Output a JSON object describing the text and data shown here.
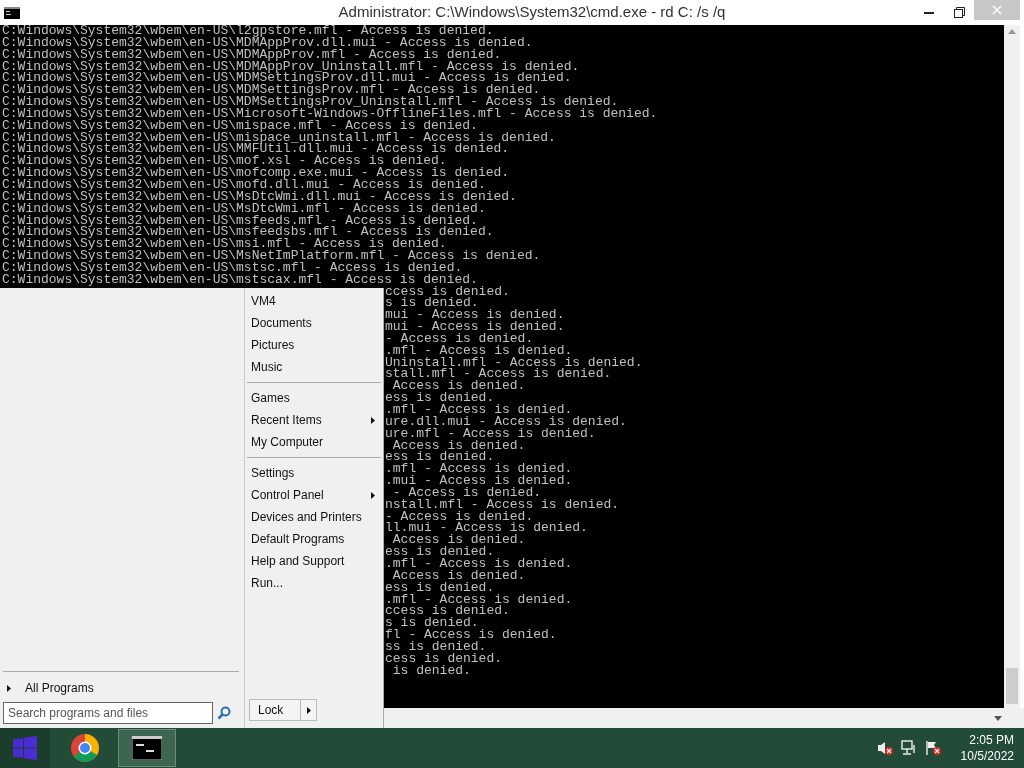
{
  "window": {
    "title": "Administrator: C:\\Windows\\System32\\cmd.exe - rd  C: /s /q"
  },
  "console": {
    "lines": [
      {
        "kind": "full",
        "text": "C:Windows\\System32\\wbem\\en-US\\l2gpstore.mfl - Access is denied."
      },
      {
        "kind": "full",
        "text": "C:Windows\\System32\\wbem\\en-US\\MDMAppProv.dll.mui - Access is denied."
      },
      {
        "kind": "full",
        "text": "C:Windows\\System32\\wbem\\en-US\\MDMAppProv.mfl - Access is denied."
      },
      {
        "kind": "full",
        "text": "C:Windows\\System32\\wbem\\en-US\\MDMAppProv_Uninstall.mfl - Access is denied."
      },
      {
        "kind": "full",
        "text": "C:Windows\\System32\\wbem\\en-US\\MDMSettingsProv.dll.mui - Access is denied."
      },
      {
        "kind": "full",
        "text": "C:Windows\\System32\\wbem\\en-US\\MDMSettingsProv.mfl - Access is denied."
      },
      {
        "kind": "full",
        "text": "C:Windows\\System32\\wbem\\en-US\\MDMSettingsProv_Uninstall.mfl - Access is denied."
      },
      {
        "kind": "full",
        "text": "C:Windows\\System32\\wbem\\en-US\\Microsoft-Windows-OfflineFiles.mfl - Access is denied."
      },
      {
        "kind": "full",
        "text": "C:Windows\\System32\\wbem\\en-US\\mispace.mfl - Access is denied."
      },
      {
        "kind": "full",
        "text": "C:Windows\\System32\\wbem\\en-US\\mispace_uninstall.mfl - Access is denied."
      },
      {
        "kind": "full",
        "text": "C:Windows\\System32\\wbem\\en-US\\MMFUtil.dll.mui - Access is denied."
      },
      {
        "kind": "full",
        "text": "C:Windows\\System32\\wbem\\en-US\\mof.xsl - Access is denied."
      },
      {
        "kind": "full",
        "text": "C:Windows\\System32\\wbem\\en-US\\mofcomp.exe.mui - Access is denied."
      },
      {
        "kind": "full",
        "text": "C:Windows\\System32\\wbem\\en-US\\mofd.dll.mui - Access is denied."
      },
      {
        "kind": "full",
        "text": "C:Windows\\System32\\wbem\\en-US\\MsDtcWmi.dll.mui - Access is denied."
      },
      {
        "kind": "full",
        "text": "C:Windows\\System32\\wbem\\en-US\\MsDtcWmi.mfl - Access is denied."
      },
      {
        "kind": "full",
        "text": "C:Windows\\System32\\wbem\\en-US\\msfeeds.mfl - Access is denied."
      },
      {
        "kind": "full",
        "text": "C:Windows\\System32\\wbem\\en-US\\msfeedsbs.mfl - Access is denied."
      },
      {
        "kind": "full",
        "text": "C:Windows\\System32\\wbem\\en-US\\msi.mfl - Access is denied."
      },
      {
        "kind": "full",
        "text": "C:Windows\\System32\\wbem\\en-US\\MsNetImPlatform.mfl - Access is denied."
      },
      {
        "kind": "full",
        "text": "C:Windows\\System32\\wbem\\en-US\\mstsc.mfl - Access is denied."
      },
      {
        "kind": "full",
        "text": "C:Windows\\System32\\wbem\\en-US\\mstscax.mfl - Access is denied."
      },
      {
        "kind": "tail",
        "text": "ccess is denied."
      },
      {
        "kind": "tail",
        "text": "s is denied."
      },
      {
        "kind": "tail",
        "text": "mui - Access is denied."
      },
      {
        "kind": "tail",
        "text": "mui - Access is denied."
      },
      {
        "kind": "tail",
        "text": "- Access is denied."
      },
      {
        "kind": "tail",
        "text": ".mfl - Access is denied."
      },
      {
        "kind": "tail",
        "text": "Uninstall.mfl - Access is denied."
      },
      {
        "kind": "tail",
        "text": "stall.mfl - Access is denied."
      },
      {
        "kind": "tail",
        "text": " Access is denied."
      },
      {
        "kind": "tail",
        "text": "ess is denied."
      },
      {
        "kind": "tail",
        "text": ".mfl - Access is denied."
      },
      {
        "kind": "tail",
        "text": "ure.dll.mui - Access is denied."
      },
      {
        "kind": "tail",
        "text": "ure.mfl - Access is denied."
      },
      {
        "kind": "tail",
        "text": " Access is denied."
      },
      {
        "kind": "tail",
        "text": "ess is denied."
      },
      {
        "kind": "tail",
        "text": ".mfl - Access is denied."
      },
      {
        "kind": "tail",
        "text": ".mui - Access is denied."
      },
      {
        "kind": "tail",
        "text": " - Access is denied."
      },
      {
        "kind": "tail",
        "text": "nstall.mfl - Access is denied."
      },
      {
        "kind": "tail",
        "text": "- Access is denied."
      },
      {
        "kind": "tail",
        "text": "ll.mui - Access is denied."
      },
      {
        "kind": "tail",
        "text": " Access is denied."
      },
      {
        "kind": "tail",
        "text": "ess is denied."
      },
      {
        "kind": "tail",
        "text": ".mfl - Access is denied."
      },
      {
        "kind": "tail",
        "text": " Access is denied."
      },
      {
        "kind": "tail",
        "text": "ess is denied."
      },
      {
        "kind": "tail",
        "text": ".mfl - Access is denied."
      },
      {
        "kind": "tail",
        "text": "ccess is denied."
      },
      {
        "kind": "tail",
        "text": "s is denied."
      },
      {
        "kind": "tail",
        "text": "fl - Access is denied."
      },
      {
        "kind": "tail",
        "text": "ss is denied."
      },
      {
        "kind": "tail",
        "text": "cess is denied."
      },
      {
        "kind": "tail",
        "text": " is denied."
      }
    ]
  },
  "start_menu": {
    "groups": [
      [
        {
          "label": "VM4",
          "submenu": false
        },
        {
          "label": "Documents",
          "submenu": false
        },
        {
          "label": "Pictures",
          "submenu": false
        },
        {
          "label": "Music",
          "submenu": false
        }
      ],
      [
        {
          "label": "Games",
          "submenu": false
        },
        {
          "label": "Recent Items",
          "submenu": true
        },
        {
          "label": "My Computer",
          "submenu": false
        }
      ],
      [
        {
          "label": "Settings",
          "submenu": false
        },
        {
          "label": "Control Panel",
          "submenu": true
        },
        {
          "label": "Devices and Printers",
          "submenu": false
        },
        {
          "label": "Default Programs",
          "submenu": false
        },
        {
          "label": "Help and Support",
          "submenu": false
        },
        {
          "label": "Run...",
          "submenu": false
        }
      ]
    ],
    "all_programs": "All Programs",
    "search": {
      "placeholder": "Search programs and files"
    },
    "lock_button": "Lock"
  },
  "taskbar": {
    "apps": [
      {
        "kind": "browser",
        "selected": false
      },
      {
        "kind": "console",
        "selected": true
      }
    ],
    "clock": {
      "time": "2:05 PM",
      "date": "10/5/2022"
    }
  }
}
